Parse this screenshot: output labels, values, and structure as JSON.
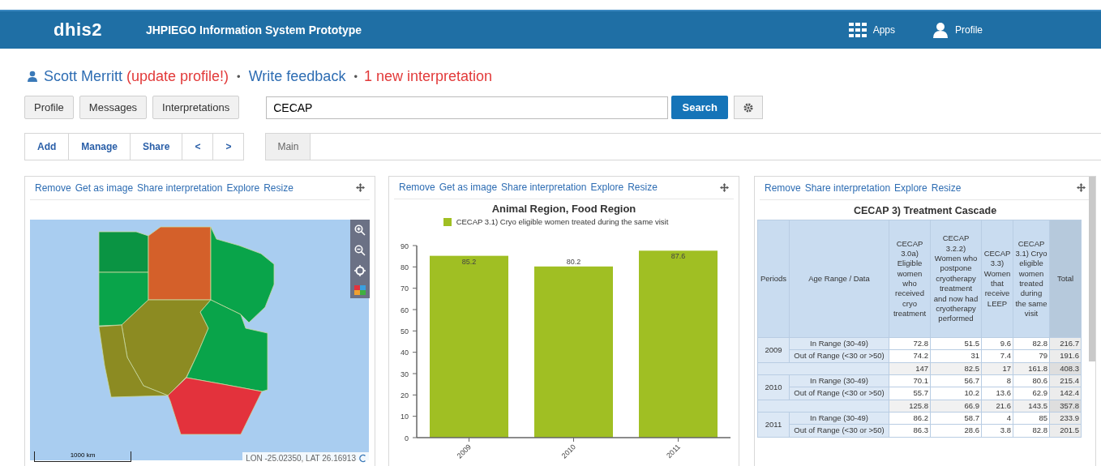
{
  "header": {
    "logo": "dhis2",
    "title": "JHPIEGO Information System Prototype",
    "menu": [
      {
        "kind": "apps",
        "label": "Apps"
      },
      {
        "kind": "profile",
        "label": "Profile"
      }
    ]
  },
  "user_bar": [
    {
      "kind": "link",
      "text": "Scott Merritt"
    },
    {
      "kind": "alert",
      "text": "(update profile!)"
    },
    {
      "kind": "separator",
      "text": "•"
    },
    {
      "kind": "link",
      "text": "Write feedback"
    },
    {
      "kind": "separator",
      "text": "•"
    },
    {
      "kind": "alert",
      "text": "1 new interpretation"
    }
  ],
  "nav_buttons": [
    "Profile",
    "Messages",
    "Interpretations"
  ],
  "search": {
    "value": "CECAP",
    "button": "Search"
  },
  "toolbar": [
    "Add",
    "Manage",
    "Share",
    "<",
    ">"
  ],
  "tabs": [
    {
      "label": "Main",
      "selected": true
    }
  ],
  "map_card": {
    "actions": [
      "Remove",
      "Get as image",
      "Share interpretation",
      "Explore",
      "Resize"
    ],
    "scale": "1000 km",
    "coordinates": "LON -25.02350, LAT 26.16913"
  },
  "chart_card": {
    "actions": [
      "Remove",
      "Get as image",
      "Share interpretation",
      "Explore",
      "Resize"
    ],
    "chart_data": {
      "type": "bar",
      "title": "Animal Region, Food Region",
      "categories": [
        "2009",
        "2010",
        "2011"
      ],
      "series": [
        {
          "name": "CECAP 3.1) Cryo eligible women treated during the same visit",
          "color": "#a0bf23",
          "values": [
            85.2,
            80.2,
            87.6
          ]
        }
      ],
      "ylim": [
        0,
        90
      ],
      "yticks": [
        0,
        10,
        20,
        30,
        40,
        50,
        60,
        70,
        80,
        90
      ],
      "data_labels": true
    }
  },
  "table_card": {
    "actions": [
      "Remove",
      "Share interpretation",
      "Explore",
      "Resize"
    ],
    "title": "CECAP 3) Treatment Cascade",
    "columns": [
      "Periods",
      "Age Range / Data",
      "CECAP 3.0a) Eligible women who received cryo treatment",
      "CECAP 3.2.2) Women who postpone cryotherapy treatment and now had cryotherapy performed",
      "CECAP 3.3) Women that receive LEEP",
      "CECAP 3.1) Cryo eligible women treated during the same visit",
      "Total"
    ],
    "periods": [
      {
        "period": "2009",
        "rows": [
          {
            "label": "In Range (30-49)",
            "values": [
              "72.8",
              "51.5",
              "9.6",
              "82.8"
            ],
            "total": "216.7"
          },
          {
            "label": "Out of Range (<30 or >50)",
            "values": [
              "74.2",
              "31",
              "7.4",
              "79"
            ],
            "total": "191.6"
          }
        ],
        "subtotal": {
          "values": [
            "147",
            "82.5",
            "17",
            "161.8"
          ],
          "total": "408.3"
        }
      },
      {
        "period": "2010",
        "rows": [
          {
            "label": "In Range (30-49)",
            "values": [
              "70.1",
              "56.7",
              "8",
              "80.6"
            ],
            "total": "215.4"
          },
          {
            "label": "Out of Range (<30 or >50)",
            "values": [
              "55.7",
              "10.2",
              "13.6",
              "62.9"
            ],
            "total": "142.4"
          }
        ],
        "subtotal": {
          "values": [
            "125.8",
            "66.9",
            "21.6",
            "143.5"
          ],
          "total": "357.8"
        }
      },
      {
        "period": "2011",
        "rows": [
          {
            "label": "In Range (30-49)",
            "values": [
              "86.2",
              "58.7",
              "4",
              "85"
            ],
            "total": "233.9"
          },
          {
            "label": "Out of Range (<30 or >50)",
            "values": [
              "86.3",
              "28.6",
              "3.8",
              "82.8"
            ],
            "total": "201.5"
          }
        ]
      }
    ]
  }
}
